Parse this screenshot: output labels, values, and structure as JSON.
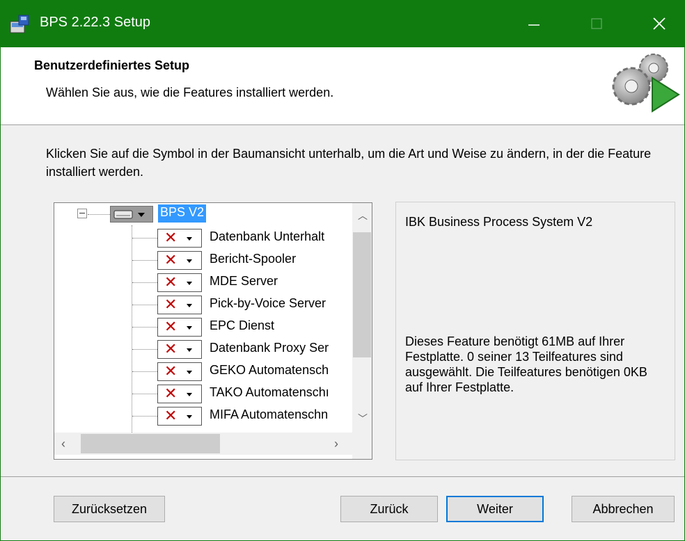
{
  "window": {
    "title": "BPS 2.22.3 Setup",
    "accent_color": "#107c10",
    "controls": [
      "minimize-icon",
      "maximize-icon",
      "close-icon"
    ]
  },
  "header": {
    "title": "Benutzerdefiniertes Setup",
    "subtitle": "Wählen Sie aus, wie die Features installiert werden.",
    "image": "gears-play-icon"
  },
  "instructions": "Klicken Sie auf die Symbol in der Baumansicht unterhalb, um die Art und Weise zu ändern, in der die Feature installiert werden.",
  "tree": {
    "root": {
      "label": "BPS V2",
      "icon": "harddrive-icon",
      "expanded": true,
      "selected": true
    },
    "features": [
      {
        "label": "Datenbank Unterhalt",
        "state": "x-icon"
      },
      {
        "label": "Bericht-Spooler",
        "state": "x-icon"
      },
      {
        "label": "MDE Server",
        "state": "x-icon"
      },
      {
        "label": "Pick-by-Voice Server",
        "state": "x-icon"
      },
      {
        "label": "EPC Dienst",
        "state": "x-icon"
      },
      {
        "label": "Datenbank Proxy Ser",
        "state": "x-icon"
      },
      {
        "label": "GEKO Automatensch",
        "state": "x-icon"
      },
      {
        "label": "TAKO Automatenschı",
        "state": "x-icon"
      },
      {
        "label": "MIFA Automatenschn",
        "state": "x-icon"
      }
    ]
  },
  "info": {
    "name": "IBK Business Process System V2",
    "description": "Dieses Feature benötigt 61MB auf Ihrer Festplatte. 0 seiner 13 Teilfeatures sind ausgewählt. Die Teilfeatures benötigen 0KB auf Ihrer Festplatte."
  },
  "buttons": {
    "reset": "Zurücksetzen",
    "back": "Zurück",
    "next": "Weiter",
    "cancel": "Abbrechen"
  }
}
